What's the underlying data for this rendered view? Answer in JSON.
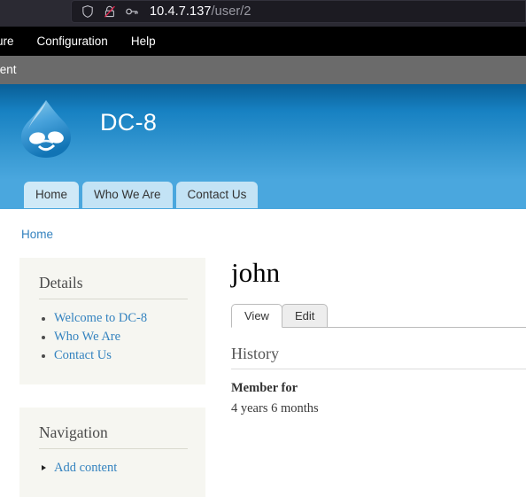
{
  "browser": {
    "url_host": "10.4.7.137",
    "url_path": "/user/2",
    "icons": [
      "shield-icon",
      "tracking-protection-blocked-icon",
      "key-icon"
    ]
  },
  "admin_toolbar": {
    "items": [
      {
        "label": "ure",
        "name": "toolbar-item-structure-clipped"
      },
      {
        "label": "Configuration",
        "name": "toolbar-item-configuration"
      },
      {
        "label": "Help",
        "name": "toolbar-item-help"
      }
    ],
    "subbar": {
      "label": "tent",
      "name": "toolbar-subitem-content-clipped"
    }
  },
  "header": {
    "site_name": "DC-8",
    "logo_name": "drupal-droplet-logo",
    "gradient_top": "#095e96",
    "gradient_bottom": "#4aa7de"
  },
  "main_nav": {
    "tabs": [
      {
        "label": "Home",
        "active": true
      },
      {
        "label": "Who We Are",
        "active": false
      },
      {
        "label": "Contact Us",
        "active": false
      }
    ]
  },
  "breadcrumb": {
    "items": [
      "Home"
    ]
  },
  "sidebar": {
    "blocks": [
      {
        "title": "Details",
        "items": [
          "Welcome to DC-8",
          "Who We Are",
          "Contact Us"
        ],
        "bullet": "disc"
      },
      {
        "title": "Navigation",
        "items": [
          "Add content"
        ],
        "bullet": "triangle"
      }
    ]
  },
  "content": {
    "user_name": "john",
    "tabs": [
      {
        "label": "View",
        "active": true
      },
      {
        "label": "Edit",
        "active": false
      }
    ],
    "section_title": "History",
    "field_label": "Member for",
    "field_value": "4 years 6 months"
  },
  "colors": {
    "link": "#3382bf",
    "header_blue": "#1781c2",
    "block_bg": "#f6f6f1",
    "toolbar_bg": "#000000",
    "subbar_bg": "#6b6b6b",
    "chrome_bg": "#2b2a33"
  }
}
